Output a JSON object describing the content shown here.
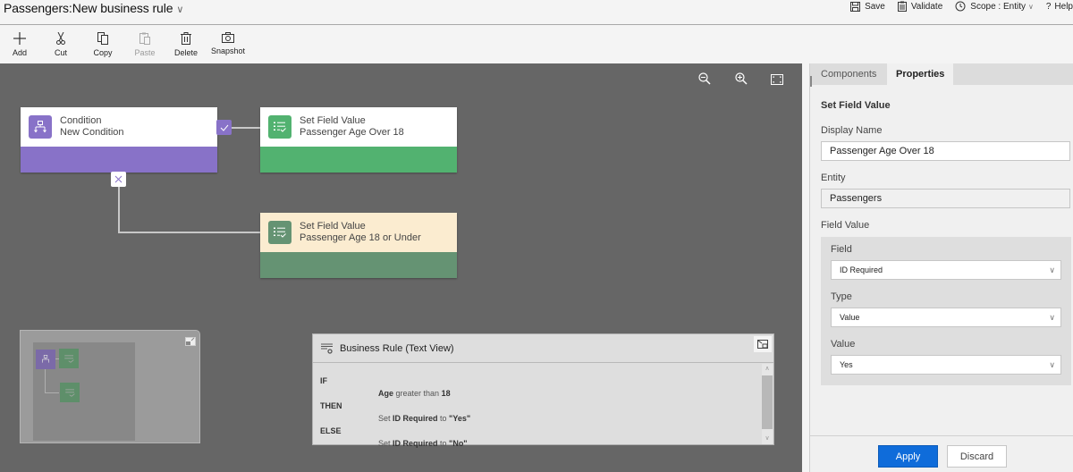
{
  "header": {
    "entity": "Passengers:",
    "rule_name": "New business rule",
    "actions": {
      "save": "Save",
      "validate": "Validate",
      "scope_label": "Scope :",
      "scope_value": "Entity",
      "help": "Help"
    }
  },
  "toolbar": {
    "add": "Add",
    "cut": "Cut",
    "copy": "Copy",
    "paste": "Paste",
    "delete": "Delete",
    "snapshot": "Snapshot"
  },
  "canvas": {
    "nodes": [
      {
        "type": "Condition",
        "name": "New Condition",
        "color": "#8872c8"
      },
      {
        "type": "Set Field Value",
        "name": "Passenger Age Over 18",
        "color": "#52b270"
      },
      {
        "type": "Set Field Value",
        "name": "Passenger Age 18 or Under",
        "color": "#659373",
        "selected": true
      }
    ]
  },
  "text_view": {
    "title": "Business Rule (Text View)",
    "if_kw": "IF",
    "then_kw": "THEN",
    "else_kw": "ELSE",
    "condition": {
      "field": "Age",
      "op": " greater than ",
      "value": "18"
    },
    "then_stmt": {
      "pre": "Set ",
      "field": "ID Required",
      "mid": " to ",
      "value": "\"Yes\""
    },
    "else_stmt": {
      "pre": "Set ",
      "field": "ID Required",
      "mid": " to ",
      "value": "\"No\""
    }
  },
  "panel": {
    "tabs": [
      "Components",
      "Properties"
    ],
    "active_tab": "Properties",
    "section_title": "Set Field Value",
    "display_name_label": "Display Name",
    "display_name_value": "Passenger Age Over 18",
    "entity_label": "Entity",
    "entity_value": "Passengers",
    "field_value_label": "Field Value",
    "field_label": "Field",
    "field_value": "ID Required",
    "type_label": "Type",
    "type_value": "Value",
    "value_label": "Value",
    "value_value": "Yes",
    "apply": "Apply",
    "discard": "Discard"
  },
  "colors": {
    "accent": "#0f6cda",
    "condition": "#8872c8",
    "action": "#52b270",
    "action_selected_head": "#fbecd0",
    "canvas_bg": "#666666"
  }
}
